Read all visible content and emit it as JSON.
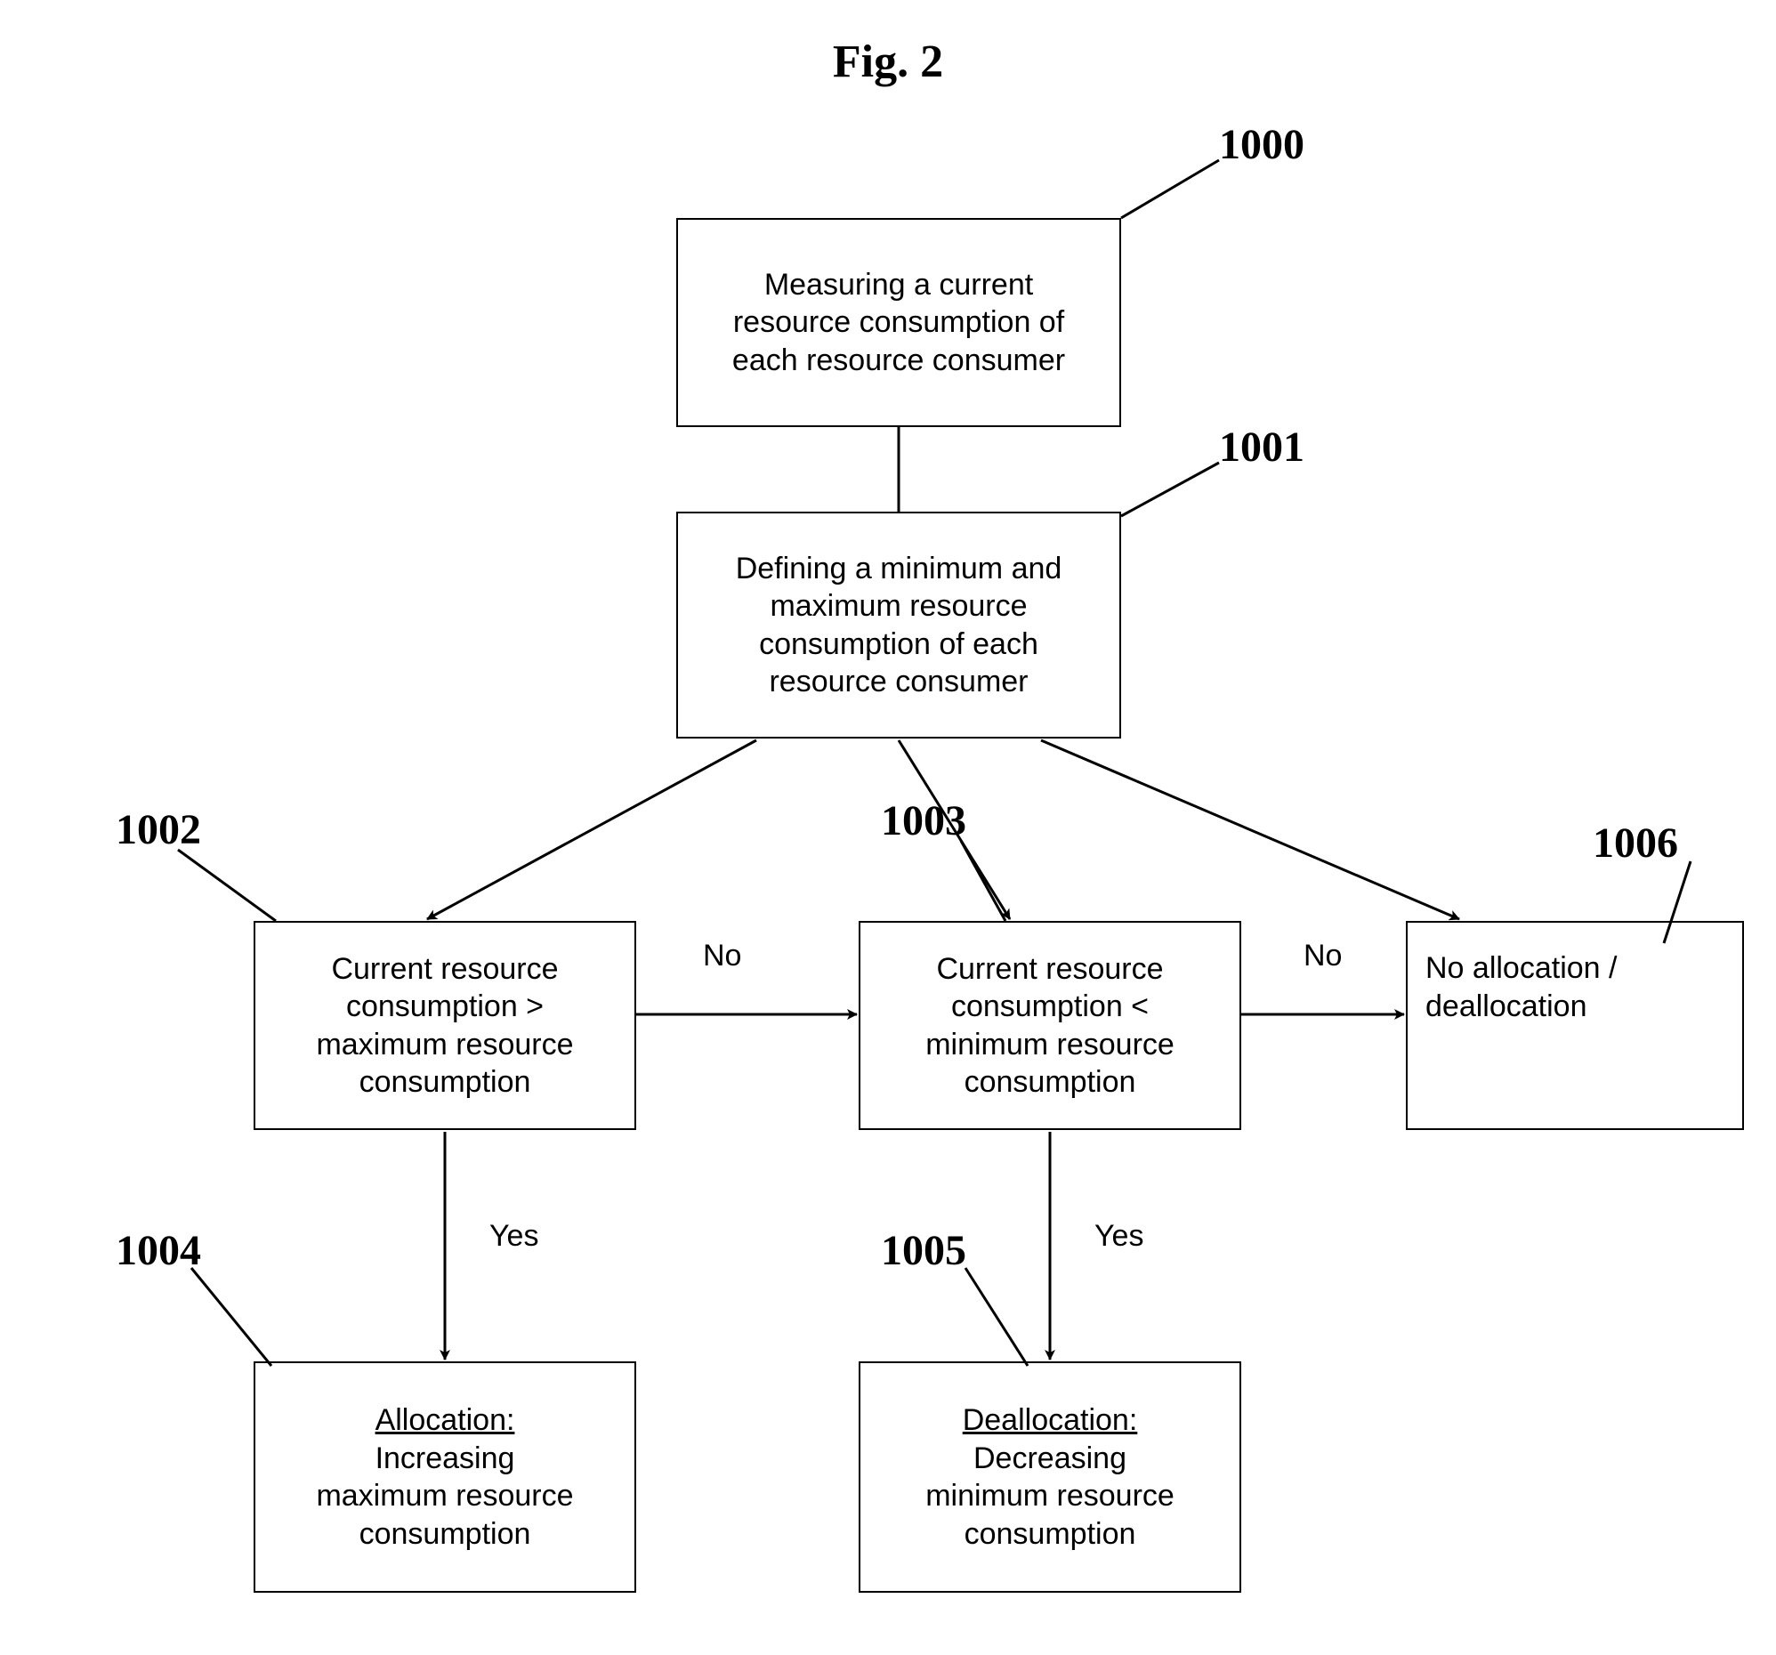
{
  "figure_title": "Fig. 2",
  "refs": {
    "b1000": "1000",
    "b1001": "1001",
    "b1002": "1002",
    "b1003": "1003",
    "b1004": "1004",
    "b1005": "1005",
    "b1006": "1006"
  },
  "boxes": {
    "b1000": {
      "lines": [
        "Measuring a current",
        "resource consumption of",
        "each resource consumer"
      ]
    },
    "b1001": {
      "lines": [
        "Defining a minimum and",
        "maximum resource",
        "consumption of each",
        "resource consumer"
      ]
    },
    "b1002": {
      "lines": [
        "Current resource",
        "consumption >",
        "maximum resource",
        "consumption"
      ]
    },
    "b1003": {
      "lines": [
        "Current resource",
        "consumption <",
        "minimum resource",
        "consumption"
      ]
    },
    "b1004": {
      "heading": "Allocation:",
      "lines": [
        "Increasing",
        "maximum resource",
        "consumption"
      ]
    },
    "b1005": {
      "heading": "Deallocation:",
      "lines": [
        "Decreasing",
        "minimum resource",
        "consumption"
      ]
    },
    "b1006": {
      "lines": [
        "No allocation /",
        "deallocation"
      ]
    }
  },
  "edge_labels": {
    "no_1002_1003": "No",
    "no_1003_1006": "No",
    "yes_1002_1004": "Yes",
    "yes_1003_1005": "Yes"
  }
}
